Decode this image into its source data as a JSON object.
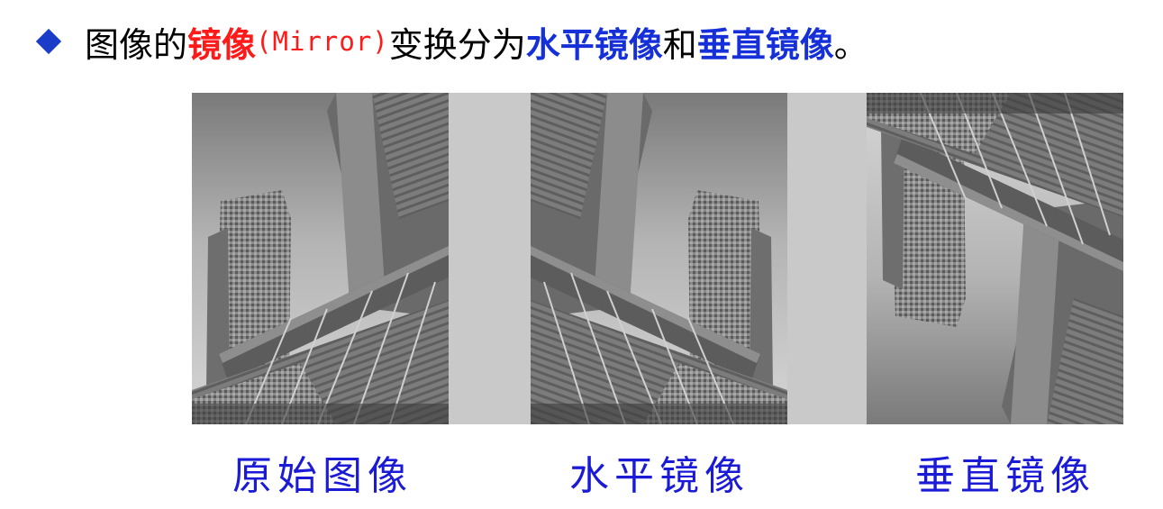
{
  "headline": {
    "part1": "图像的",
    "part2": "镜像",
    "part3": "(Mirror)",
    "part4": "变换分为",
    "part5": "水平镜像",
    "part6": "和",
    "part7": "垂直镜像",
    "part8": "。"
  },
  "captions": {
    "original": "原始图像",
    "horizontal": "水平镜像",
    "vertical": "垂直镜像"
  },
  "colors": {
    "bullet": "#1a3cc8",
    "highlight_red": "#ff1a1a",
    "highlight_blue": "#1530d8",
    "caption": "#1b1bd6"
  },
  "icons": {
    "bullet": "diamond-bullet-icon"
  }
}
